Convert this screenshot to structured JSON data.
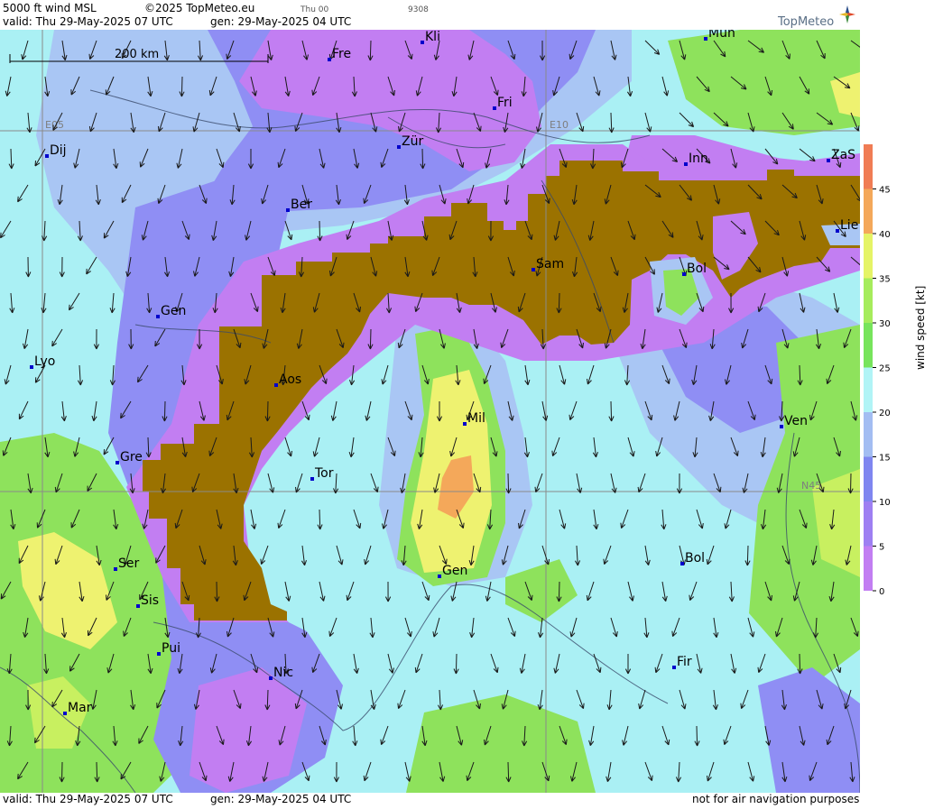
{
  "header": {
    "product": "5000 ft wind MSL",
    "copyright": "©2025 TopMeteo.eu",
    "valid": "valid:  Thu  29-May-2025  07 UTC",
    "gen": "gen: 29-May-2025 04 UTC",
    "small_day": "Thu 00",
    "small_code": "9308",
    "brand": "TopMeteo"
  },
  "footer": {
    "valid": "valid:  Thu  29-May-2025  07 UTC",
    "gen": "gen: 29-May-2025 04 UTC",
    "disclaimer": "not for air navigation purposes"
  },
  "scale_bar": {
    "label": "200 km"
  },
  "grid_labels": [
    "E05",
    "E10",
    "N45"
  ],
  "cities": [
    "Kli",
    "Mün",
    "Fre",
    "Fri",
    "Zür",
    "Dij",
    "Inn",
    "ZaS",
    "Ber",
    "Lie",
    "Sam",
    "Bol",
    "Gen",
    "Lyo",
    "Aos",
    "Mil",
    "Ven",
    "Gre",
    "Tor",
    "N45",
    "Ser",
    "Gen",
    "Bol",
    "Sis",
    "Pui",
    "Fir",
    "Nic",
    "Mar"
  ],
  "legend": {
    "title": "wind speed [kt]",
    "ticks": [
      "0",
      "5",
      "10",
      "15",
      "20",
      "25",
      "30",
      "35",
      "40",
      "45"
    ],
    "colors": [
      "#c27ef2",
      "#9e7ff2",
      "#7f86f0",
      "#a3bdf2",
      "#b1f4f6",
      "#77e45c",
      "#a6ec5c",
      "#e5f466",
      "#f4a85a",
      "#f07c54"
    ]
  },
  "colors": {
    "terrain": "#9b7200",
    "calm": "#aaf0f4",
    "violet": "#c27ef2",
    "blue": "#8f8ef4",
    "lightblue": "#a9c6f4",
    "green": "#8ee25c",
    "yellow": "#eef270",
    "orange": "#f4a85a"
  }
}
